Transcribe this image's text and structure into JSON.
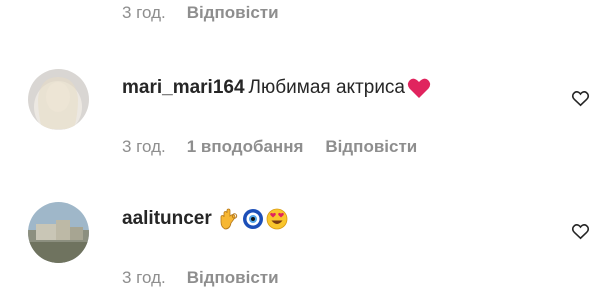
{
  "comments": [
    {
      "time": "3 год.",
      "reply": "Відповісти"
    },
    {
      "username": "mari_mari164",
      "text": "Любимая актриса",
      "emojis": [
        "red-heart-icon"
      ],
      "time": "3 год.",
      "likes": "1 вподобання",
      "reply": "Відповісти"
    },
    {
      "username": "aalituncer",
      "text": "",
      "emojis": [
        "ok-hand-icon",
        "nazar-amulet-icon",
        "heart-eyes-icon"
      ],
      "time": "3 год.",
      "reply": "Відповісти"
    }
  ],
  "colors": {
    "meta": "#8e8e8e",
    "text": "#262626",
    "heart": "#e0245e"
  }
}
